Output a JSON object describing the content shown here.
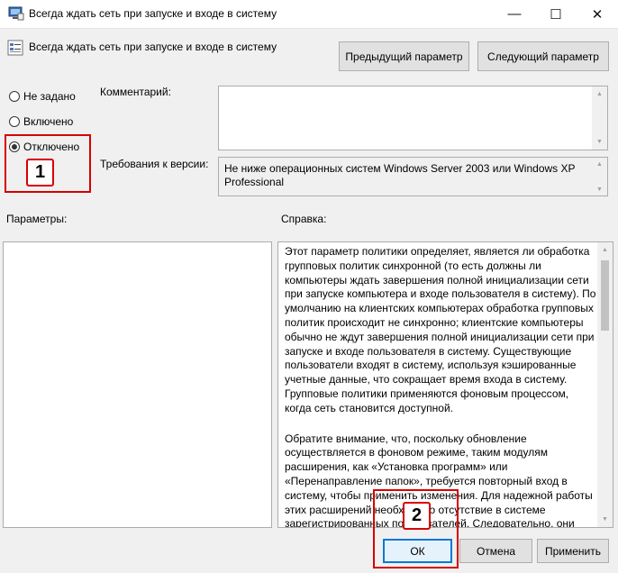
{
  "window": {
    "title": "Всегда ждать сеть при запуске и входе в систему",
    "minimize_glyph": "—",
    "maximize_glyph": "☐",
    "close_glyph": "✕"
  },
  "header": {
    "policy_name": "Всегда ждать сеть при запуске и входе в систему",
    "prev_button": "Предыдущий параметр",
    "next_button": "Следующий параметр"
  },
  "state": {
    "options": [
      {
        "label": "Не задано",
        "selected": false
      },
      {
        "label": "Включено",
        "selected": false
      },
      {
        "label": "Отключено",
        "selected": true
      }
    ]
  },
  "comment": {
    "label": "Комментарий:",
    "value": ""
  },
  "requirements": {
    "label": "Требования к версии:",
    "value": "Не ниже операционных систем Windows Server 2003 или Windows XP Professional"
  },
  "params": {
    "label": "Параметры:"
  },
  "help": {
    "label": "Справка:",
    "paragraphs": [
      "Этот параметр политики определяет, является ли обработка групповых политик синхронной (то есть должны ли компьютеры ждать завершения полной инициализации сети при запуске компьютера и входе пользователя в систему). По умолчанию на клиентских компьютерах обработка групповых политик происходит не синхронно; клиентские компьютеры обычно не ждут завершения полной инициализации сети при запуске и входе пользователя в систему. Существующие пользователи входят в систему, используя кэшированные учетные данные, что сокращает время входа в систему. Групповые политики применяются фоновым процессом, когда сеть становится доступной.",
      "Обратите внимание, что, поскольку обновление осуществляется в фоновом режиме, таким модулям расширения, как «Установка программ» или «Перенаправление папок», требуется повторный вход в систему, чтобы применить изменения. Для надежной работы этих расширений необходимо отсутствие в системе зарегистрированных пользователей. Следовательно, они должны быть отработаны до начала активного"
    ]
  },
  "footer": {
    "ok": "ОК",
    "cancel": "Отмена",
    "apply": "Применить"
  },
  "annotations": {
    "badge1": "1",
    "badge2": "2",
    "color": "#d60000"
  }
}
